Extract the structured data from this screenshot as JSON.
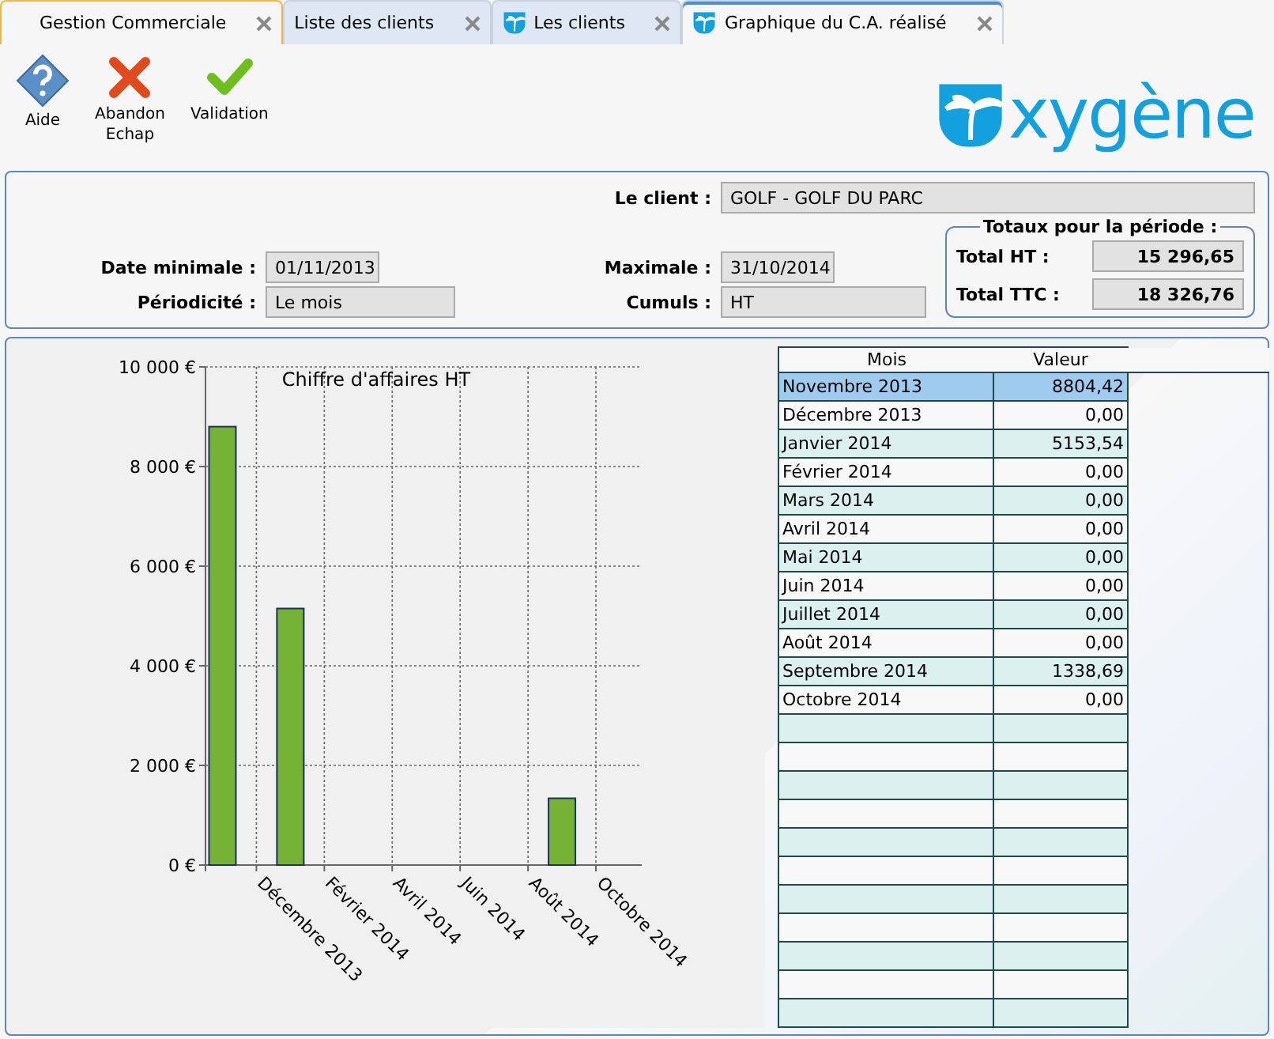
{
  "tabs": [
    {
      "label": "Gestion Commerciale",
      "selected": false,
      "icon": false
    },
    {
      "label": "Liste des clients",
      "selected": false,
      "icon": false
    },
    {
      "label": "Les clients",
      "selected": false,
      "icon": true
    },
    {
      "label": "Graphique du C.A. réalisé",
      "selected": true,
      "icon": true
    }
  ],
  "toolbar": [
    {
      "kind": "help",
      "label": "Aide"
    },
    {
      "kind": "cancel",
      "label": "Abandon\nEchap"
    },
    {
      "kind": "validate",
      "label": "Validation"
    }
  ],
  "logo": {
    "text": "xygène"
  },
  "form": {
    "client_label": "Le client :",
    "client": "GOLF - GOLF DU PARC",
    "date_min_label": "Date minimale :",
    "date_min": "01/11/2013",
    "date_max_label": "Maximale :",
    "date_max": "31/10/2014",
    "period_label": "Périodicité :",
    "period": "Le mois",
    "cumul_label": "Cumuls :",
    "cumul": "HT",
    "totals": {
      "title": "Totaux pour la période :",
      "rows": [
        {
          "label": "Total HT :",
          "value": "15 296,65"
        },
        {
          "label": "Total TTC :",
          "value": "18 326,76"
        }
      ]
    }
  },
  "chart_data": {
    "type": "bar",
    "title": "Chiffre d'affaires HT",
    "grid": true,
    "categories": [
      null,
      "Décembre 2013",
      null,
      "Février 2014",
      null,
      "Avril 2014",
      null,
      "Juin 2014",
      null,
      "Août 2014",
      null,
      "Octobre 2014"
    ],
    "series": [
      {
        "color": "#76b236",
        "values": [
          8800,
          0,
          5150,
          0,
          0,
          0,
          0,
          0,
          0,
          0,
          1340,
          0
        ]
      }
    ],
    "ylim": [
      0,
      10000
    ],
    "yticks": [
      {
        "value": 0,
        "label": "0 €"
      },
      {
        "value": 2000,
        "label": "2 000 €"
      },
      {
        "value": 4000,
        "label": "4 000 €"
      },
      {
        "value": 6000,
        "label": "6 000 €"
      },
      {
        "value": 8000,
        "label": "8 000 €"
      },
      {
        "value": 10000,
        "label": "10 000 €"
      }
    ]
  },
  "table": {
    "columns": [
      "Mois",
      "Valeur"
    ],
    "rows": [
      {
        "cells": [
          "Novembre 2013",
          "8804,42"
        ],
        "selected": true
      },
      {
        "cells": [
          "Décembre 2013",
          "0,00"
        ],
        "selected": false
      },
      {
        "cells": [
          "Janvier 2014",
          "5153,54"
        ],
        "selected": false
      },
      {
        "cells": [
          "Février 2014",
          "0,00"
        ],
        "selected": false
      },
      {
        "cells": [
          "Mars 2014",
          "0,00"
        ],
        "selected": false
      },
      {
        "cells": [
          "Avril 2014",
          "0,00"
        ],
        "selected": false
      },
      {
        "cells": [
          "Mai 2014",
          "0,00"
        ],
        "selected": false
      },
      {
        "cells": [
          "Juin 2014",
          "0,00"
        ],
        "selected": false
      },
      {
        "cells": [
          "Juillet 2014",
          "0,00"
        ],
        "selected": false
      },
      {
        "cells": [
          "Août 2014",
          "0,00"
        ],
        "selected": false
      },
      {
        "cells": [
          "Septembre 2014",
          "1338,69"
        ],
        "selected": false
      },
      {
        "cells": [
          "Octobre 2014",
          "0,00"
        ],
        "selected": false
      }
    ]
  }
}
